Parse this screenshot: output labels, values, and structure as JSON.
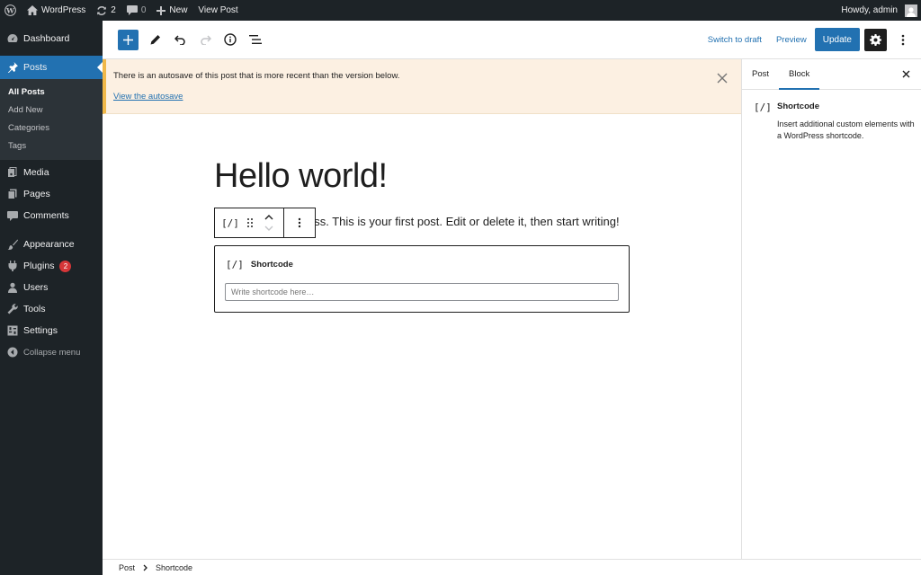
{
  "admin_bar": {
    "site_name": "WordPress",
    "updates_count": "2",
    "comments_count": "0",
    "new_label": "New",
    "view_post_label": "View Post",
    "greeting": "Howdy, admin"
  },
  "sidebar": {
    "items": [
      {
        "label": "Dashboard",
        "icon": "dashboard-icon"
      },
      {
        "label": "Posts",
        "icon": "pin-icon",
        "active": true
      },
      {
        "label": "Media",
        "icon": "media-icon"
      },
      {
        "label": "Pages",
        "icon": "pages-icon"
      },
      {
        "label": "Comments",
        "icon": "comments-icon"
      },
      {
        "label": "Appearance",
        "icon": "appearance-icon"
      },
      {
        "label": "Plugins",
        "icon": "plugins-icon",
        "badge": "2"
      },
      {
        "label": "Users",
        "icon": "users-icon"
      },
      {
        "label": "Tools",
        "icon": "tools-icon"
      },
      {
        "label": "Settings",
        "icon": "settings-icon"
      }
    ],
    "posts_submenu": [
      "All Posts",
      "Add New",
      "Categories",
      "Tags"
    ],
    "collapse_label": "Collapse menu"
  },
  "toolbar": {
    "switch_to_draft": "Switch to draft",
    "preview": "Preview",
    "update": "Update"
  },
  "notice": {
    "message": "There is an autosave of this post that is more recent than the version below.",
    "link": "View the autosave"
  },
  "editor": {
    "title": "Hello world!",
    "paragraph_visible": "ess. This is your first post. Edit or delete it, then start writing!",
    "shortcode_icon_text": "[/]",
    "shortcode_label": "Shortcode",
    "shortcode_placeholder": "Write shortcode here…"
  },
  "settings_panel": {
    "tabs": [
      "Post",
      "Block"
    ],
    "active_tab": "Block",
    "block_icon_text": "[/]",
    "block_title": "Shortcode",
    "block_description": "Insert additional custom elements with a WordPress shortcode."
  },
  "breadcrumb": {
    "items": [
      "Post",
      "Shortcode"
    ]
  },
  "colors": {
    "accent": "#2271b1",
    "admin_dark": "#1d2327",
    "notice_bg": "#fcf0e2",
    "notice_border": "#f0b849",
    "badge": "#d63638"
  }
}
